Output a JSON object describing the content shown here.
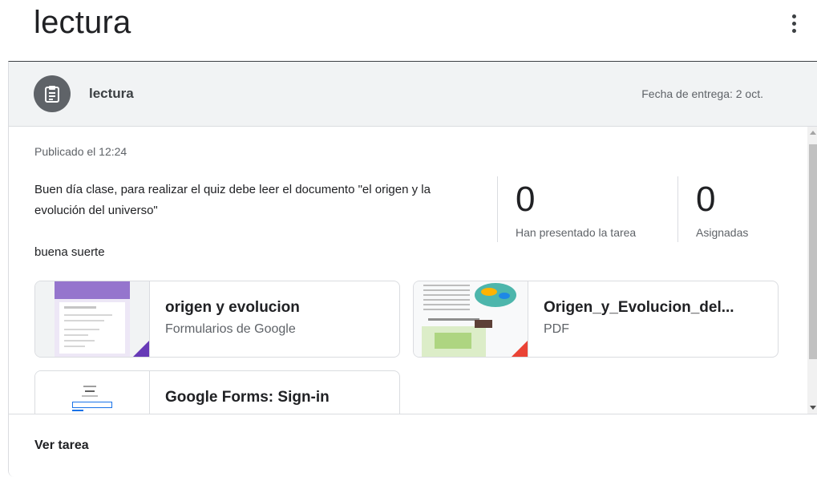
{
  "page": {
    "title": "lectura"
  },
  "assignment": {
    "title": "lectura",
    "due": "Fecha de entrega: 2 oct.",
    "posted": "Publicado el 12:24",
    "description": "Buen día clase, para realizar el quiz debe leer el documento \"el origen y la evolución del universo\"",
    "closing": "buena suerte"
  },
  "stats": [
    {
      "value": "0",
      "label": "Han presentado la tarea"
    },
    {
      "value": "0",
      "label": "Asignadas"
    }
  ],
  "attachments": [
    {
      "title": "origen y evolucion",
      "type": "Formularios de Google",
      "icon": "google-forms-icon",
      "accent": "#673ab7"
    },
    {
      "title": "Origen_y_Evolucion_del...",
      "type": "PDF",
      "icon": "pdf-icon",
      "accent": "#ea4335"
    },
    {
      "title": "Google Forms: Sign-in",
      "type": "",
      "icon": "link-icon",
      "accent": "#1a73e8"
    }
  ],
  "footer": {
    "view_label": "Ver tarea"
  }
}
